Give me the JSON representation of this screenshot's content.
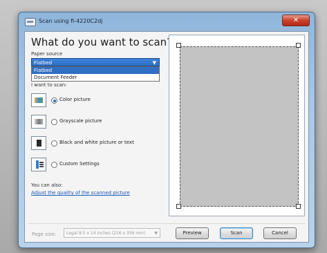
{
  "window": {
    "title": "Scan using fi-4220C2dj",
    "close_label": "✕"
  },
  "main": {
    "heading": "What do you want to scan?",
    "paper_source_label": "Paper source",
    "paper_source_value": "Flatbed",
    "paper_source_options": [
      "Flatbed",
      "Document Feeder"
    ],
    "want_label": "I want to scan:",
    "choices": [
      {
        "label": "Color picture",
        "icon": "color-picture-icon",
        "selected": true
      },
      {
        "label": "Grayscale picture",
        "icon": "grayscale-picture-icon",
        "selected": false
      },
      {
        "label": "Black and white picture or text",
        "icon": "bw-text-icon",
        "selected": false
      },
      {
        "label": "Custom Settings",
        "icon": "custom-settings-icon",
        "selected": false
      }
    ],
    "also_label": "You can also:",
    "adjust_link": "Adjust the quality of the scanned picture"
  },
  "footer": {
    "page_size_label": "Page size:",
    "page_size_value": "Legal 8.5 x 14 inches (216 x 356 mm)",
    "preview_label": "Preview",
    "scan_label": "Scan",
    "cancel_label": "Cancel"
  },
  "colors": {
    "selection": "#2f6fc4",
    "link": "#1b59b4",
    "preview_bed": "#c3c3c3"
  }
}
